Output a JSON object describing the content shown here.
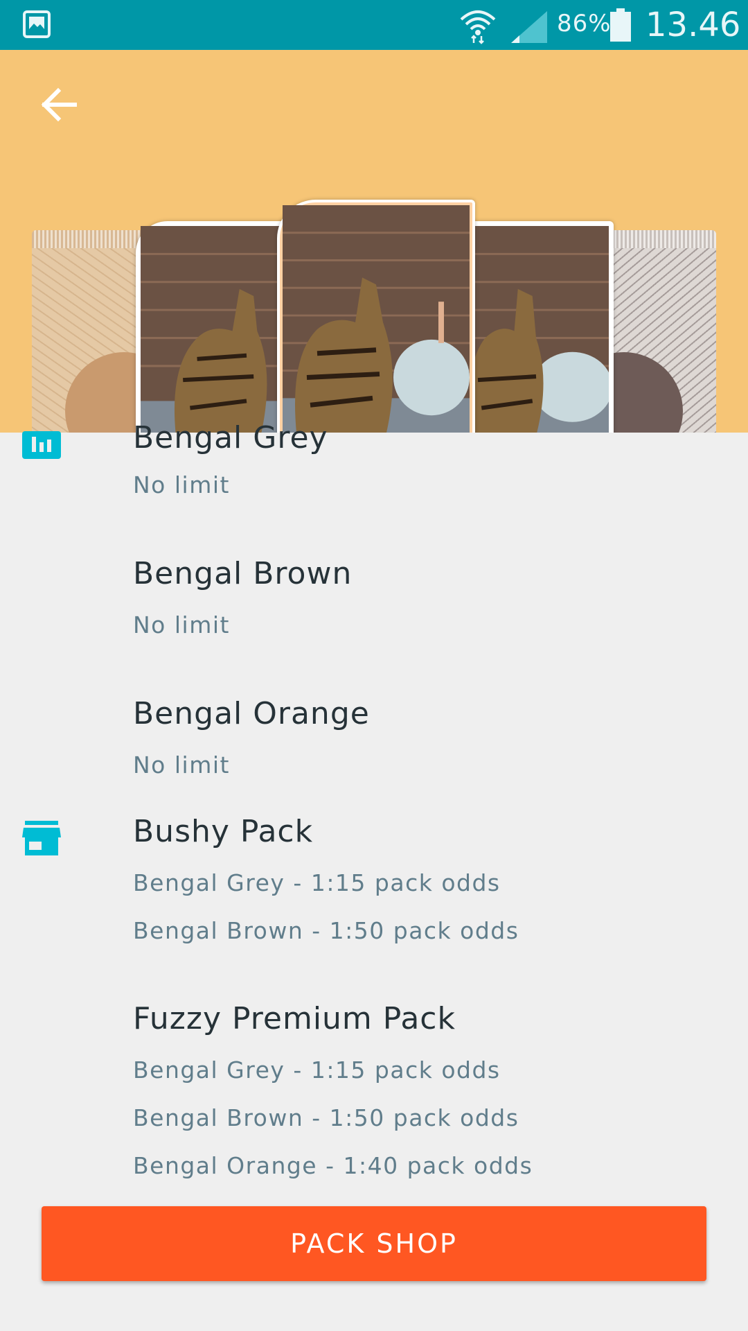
{
  "status_bar": {
    "battery_percent": "86%",
    "time": "13.46",
    "icons": [
      "gallery-icon",
      "wifi-icon",
      "signal-icon",
      "battery-icon"
    ]
  },
  "header": {
    "background_color": "#F6C576",
    "back_icon": "arrow-left-icon"
  },
  "list": {
    "cards_section_icon": "bar-chart-icon",
    "cards": [
      {
        "title": "Bengal Grey",
        "subtitle": "No limit"
      },
      {
        "title": "Bengal Brown",
        "subtitle": "No limit"
      },
      {
        "title": "Bengal Orange",
        "subtitle": "No limit"
      }
    ],
    "packs_section_icon": "store-icon",
    "packs": [
      {
        "title": "Bushy Pack",
        "odds": [
          "Bengal Grey - 1:15 pack odds",
          "Bengal Brown - 1:50 pack odds"
        ]
      },
      {
        "title": "Fuzzy Premium Pack",
        "odds": [
          "Bengal Grey - 1:15 pack odds",
          "Bengal Brown - 1:50 pack odds",
          "Bengal Orange - 1:40 pack odds"
        ]
      }
    ]
  },
  "button": {
    "label": "PACK SHOP",
    "color": "#FF5722"
  },
  "colors": {
    "status_bar": "#0097A7",
    "accent_icon": "#00BCD4",
    "background": "#EFEFEF"
  }
}
